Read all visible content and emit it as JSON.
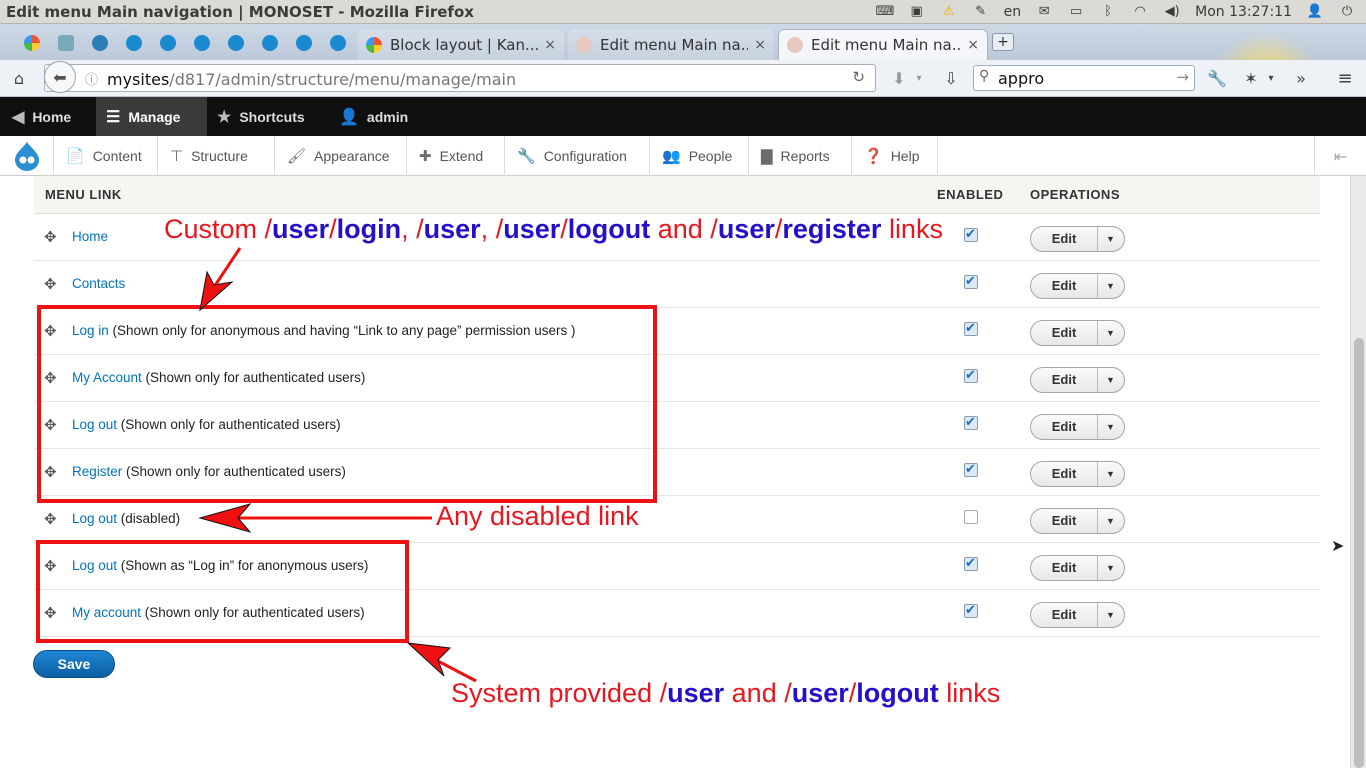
{
  "os": {
    "window_title": "Edit menu Main navigation | MONOSET - Mozilla Firefox",
    "lang": "en",
    "clock": "Mon 13:27:11"
  },
  "browser": {
    "tabs": [
      {
        "label": "Block layout | Kan...",
        "close": "×"
      },
      {
        "label": "Edit menu Main na...",
        "close": "×"
      },
      {
        "label": "Edit menu Main na...",
        "close": "×"
      }
    ],
    "new_tab": "+",
    "url_host": "mysites",
    "url_path": "/d817/admin/structure/menu/manage/main",
    "search_value": "appro"
  },
  "toolbar": {
    "home": "Home",
    "manage": "Manage",
    "shortcuts": "Shortcuts",
    "user": "admin"
  },
  "tray": {
    "items": [
      "Content",
      "Structure",
      "Appearance",
      "Extend",
      "Configuration",
      "People",
      "Reports",
      "Help"
    ]
  },
  "table": {
    "col_link": "MENU LINK",
    "col_enabled": "ENABLED",
    "col_ops": "OPERATIONS",
    "edit_label": "Edit",
    "rows": [
      {
        "link": "Home",
        "note": ""
      },
      {
        "link": "Contacts",
        "note": ""
      },
      {
        "link": "Log in",
        "note": " (Shown only for anonymous and having “Link to any page” permission users )"
      },
      {
        "link": "My Account",
        "note": " (Shown only for authenticated users)"
      },
      {
        "link": "Log out",
        "note": " (Shown only for authenticated users)"
      },
      {
        "link": "Register",
        "note": " (Shown only for authenticated users)"
      },
      {
        "link": "Log out",
        "note": " (disabled)"
      },
      {
        "link": "Log out",
        "note": " (Shown as “Log in” for anonymous users)"
      },
      {
        "link": "My account",
        "note": " (Shown only for authenticated users)"
      }
    ],
    "enabled": [
      true,
      true,
      true,
      true,
      true,
      true,
      false,
      true,
      true
    ]
  },
  "save_label": "Save",
  "annotations": {
    "custom": {
      "p1": "Custom ",
      "s1": "/",
      "b1": "user",
      "s2": "/",
      "b2": "login",
      "p2": ", ",
      "s3": "/",
      "b3": "user",
      "p3": ", ",
      "s4": "/",
      "b4": "user",
      "s5": "/",
      "b5": "logout",
      "p4": " and ",
      "s6": "/",
      "b6": "user",
      "s7": "/",
      "b7": "register",
      "p5": " links"
    },
    "disabled": "Any disabled link",
    "system": {
      "p1": "System provided ",
      "s1": "/",
      "b1": "user",
      "p2": " and ",
      "s2": "/",
      "b2": "user",
      "s3": "/",
      "b3": "logout",
      "p3": " links"
    }
  },
  "colors": {
    "annotation_red": "#e8161e",
    "annotation_blue": "#2410c8",
    "link_blue": "#0074bd",
    "save_blue": "#1475c2"
  }
}
